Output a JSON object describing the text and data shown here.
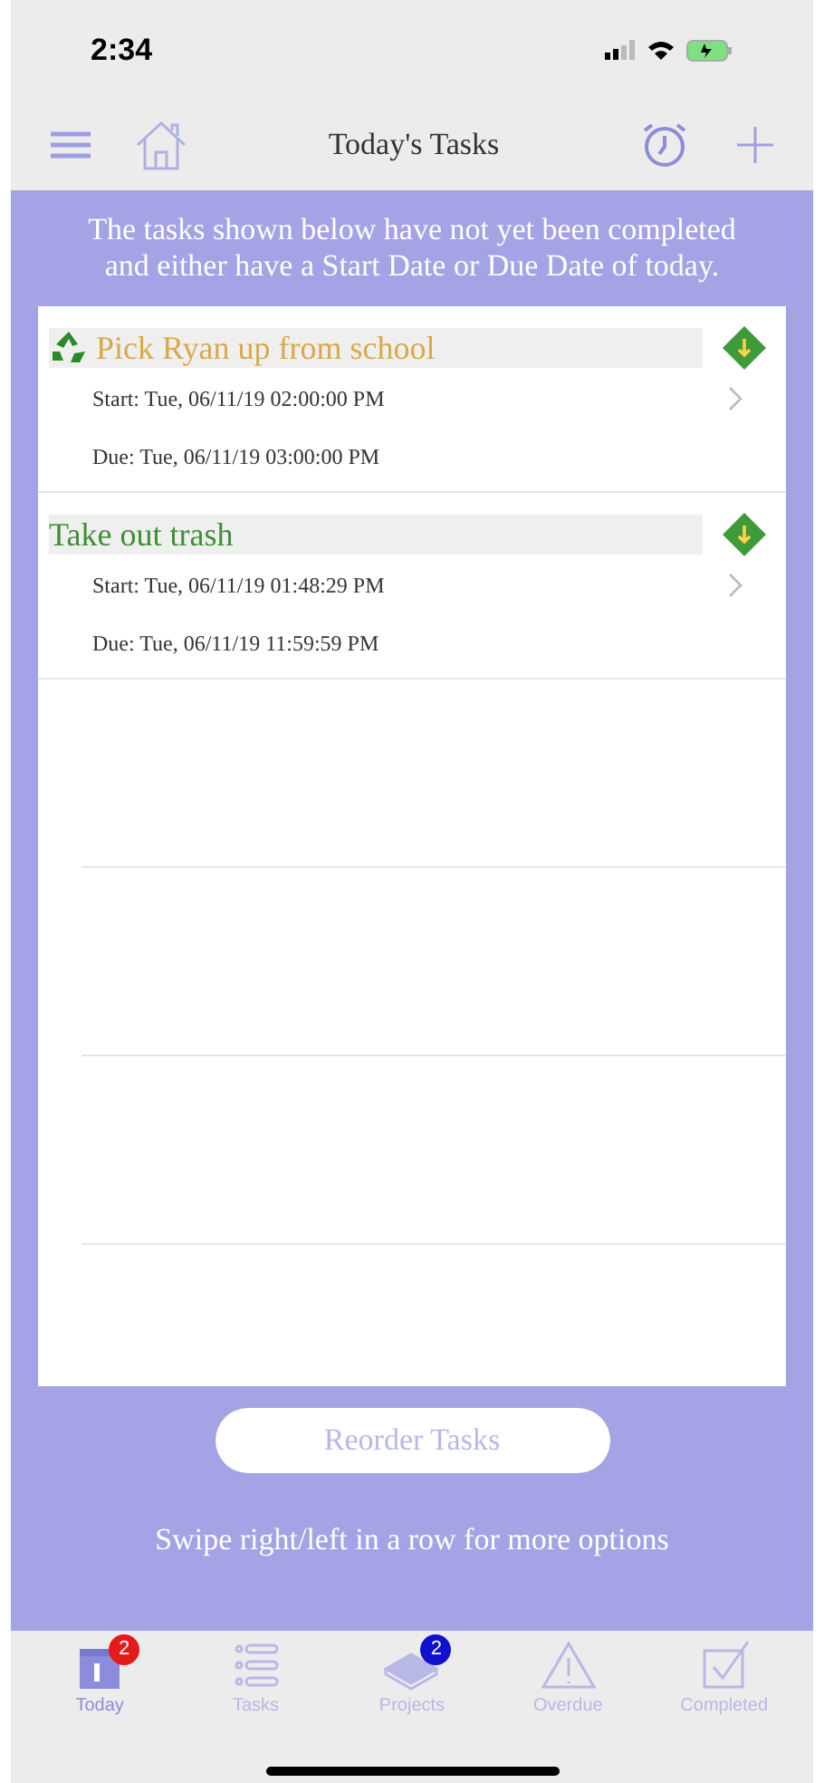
{
  "status_bar": {
    "time": "2:34"
  },
  "nav": {
    "title": "Today's Tasks"
  },
  "intro": "The tasks shown below have not yet been completed and either have a Start Date or Due Date of today.",
  "tasks": [
    {
      "title": "Pick Ryan up from school",
      "color": "#d9a94a",
      "recurring": true,
      "start": "Start: Tue, 06/11/19 02:00:00 PM",
      "due": "Due: Tue, 06/11/19 03:00:00 PM"
    },
    {
      "title": "Take out trash",
      "color": "#3f8f34",
      "recurring": false,
      "start": "Start: Tue, 06/11/19 01:48:29 PM",
      "due": "Due: Tue, 06/11/19 11:59:59 PM"
    }
  ],
  "reorder_button": "Reorder Tasks",
  "hint": "Swipe right/left in a row for more options",
  "tab_bar": [
    {
      "kind": "today",
      "label": "Today",
      "selected": true,
      "badge": {
        "text": "2",
        "color": "#e31b1b"
      }
    },
    {
      "kind": "tasks",
      "label": "Tasks",
      "selected": false
    },
    {
      "kind": "projects",
      "label": "Projects",
      "selected": false,
      "badge": {
        "text": "2",
        "color": "#1010d0"
      }
    },
    {
      "kind": "overdue",
      "label": "Overdue",
      "selected": false
    },
    {
      "kind": "completed",
      "label": "Completed",
      "selected": false
    }
  ]
}
